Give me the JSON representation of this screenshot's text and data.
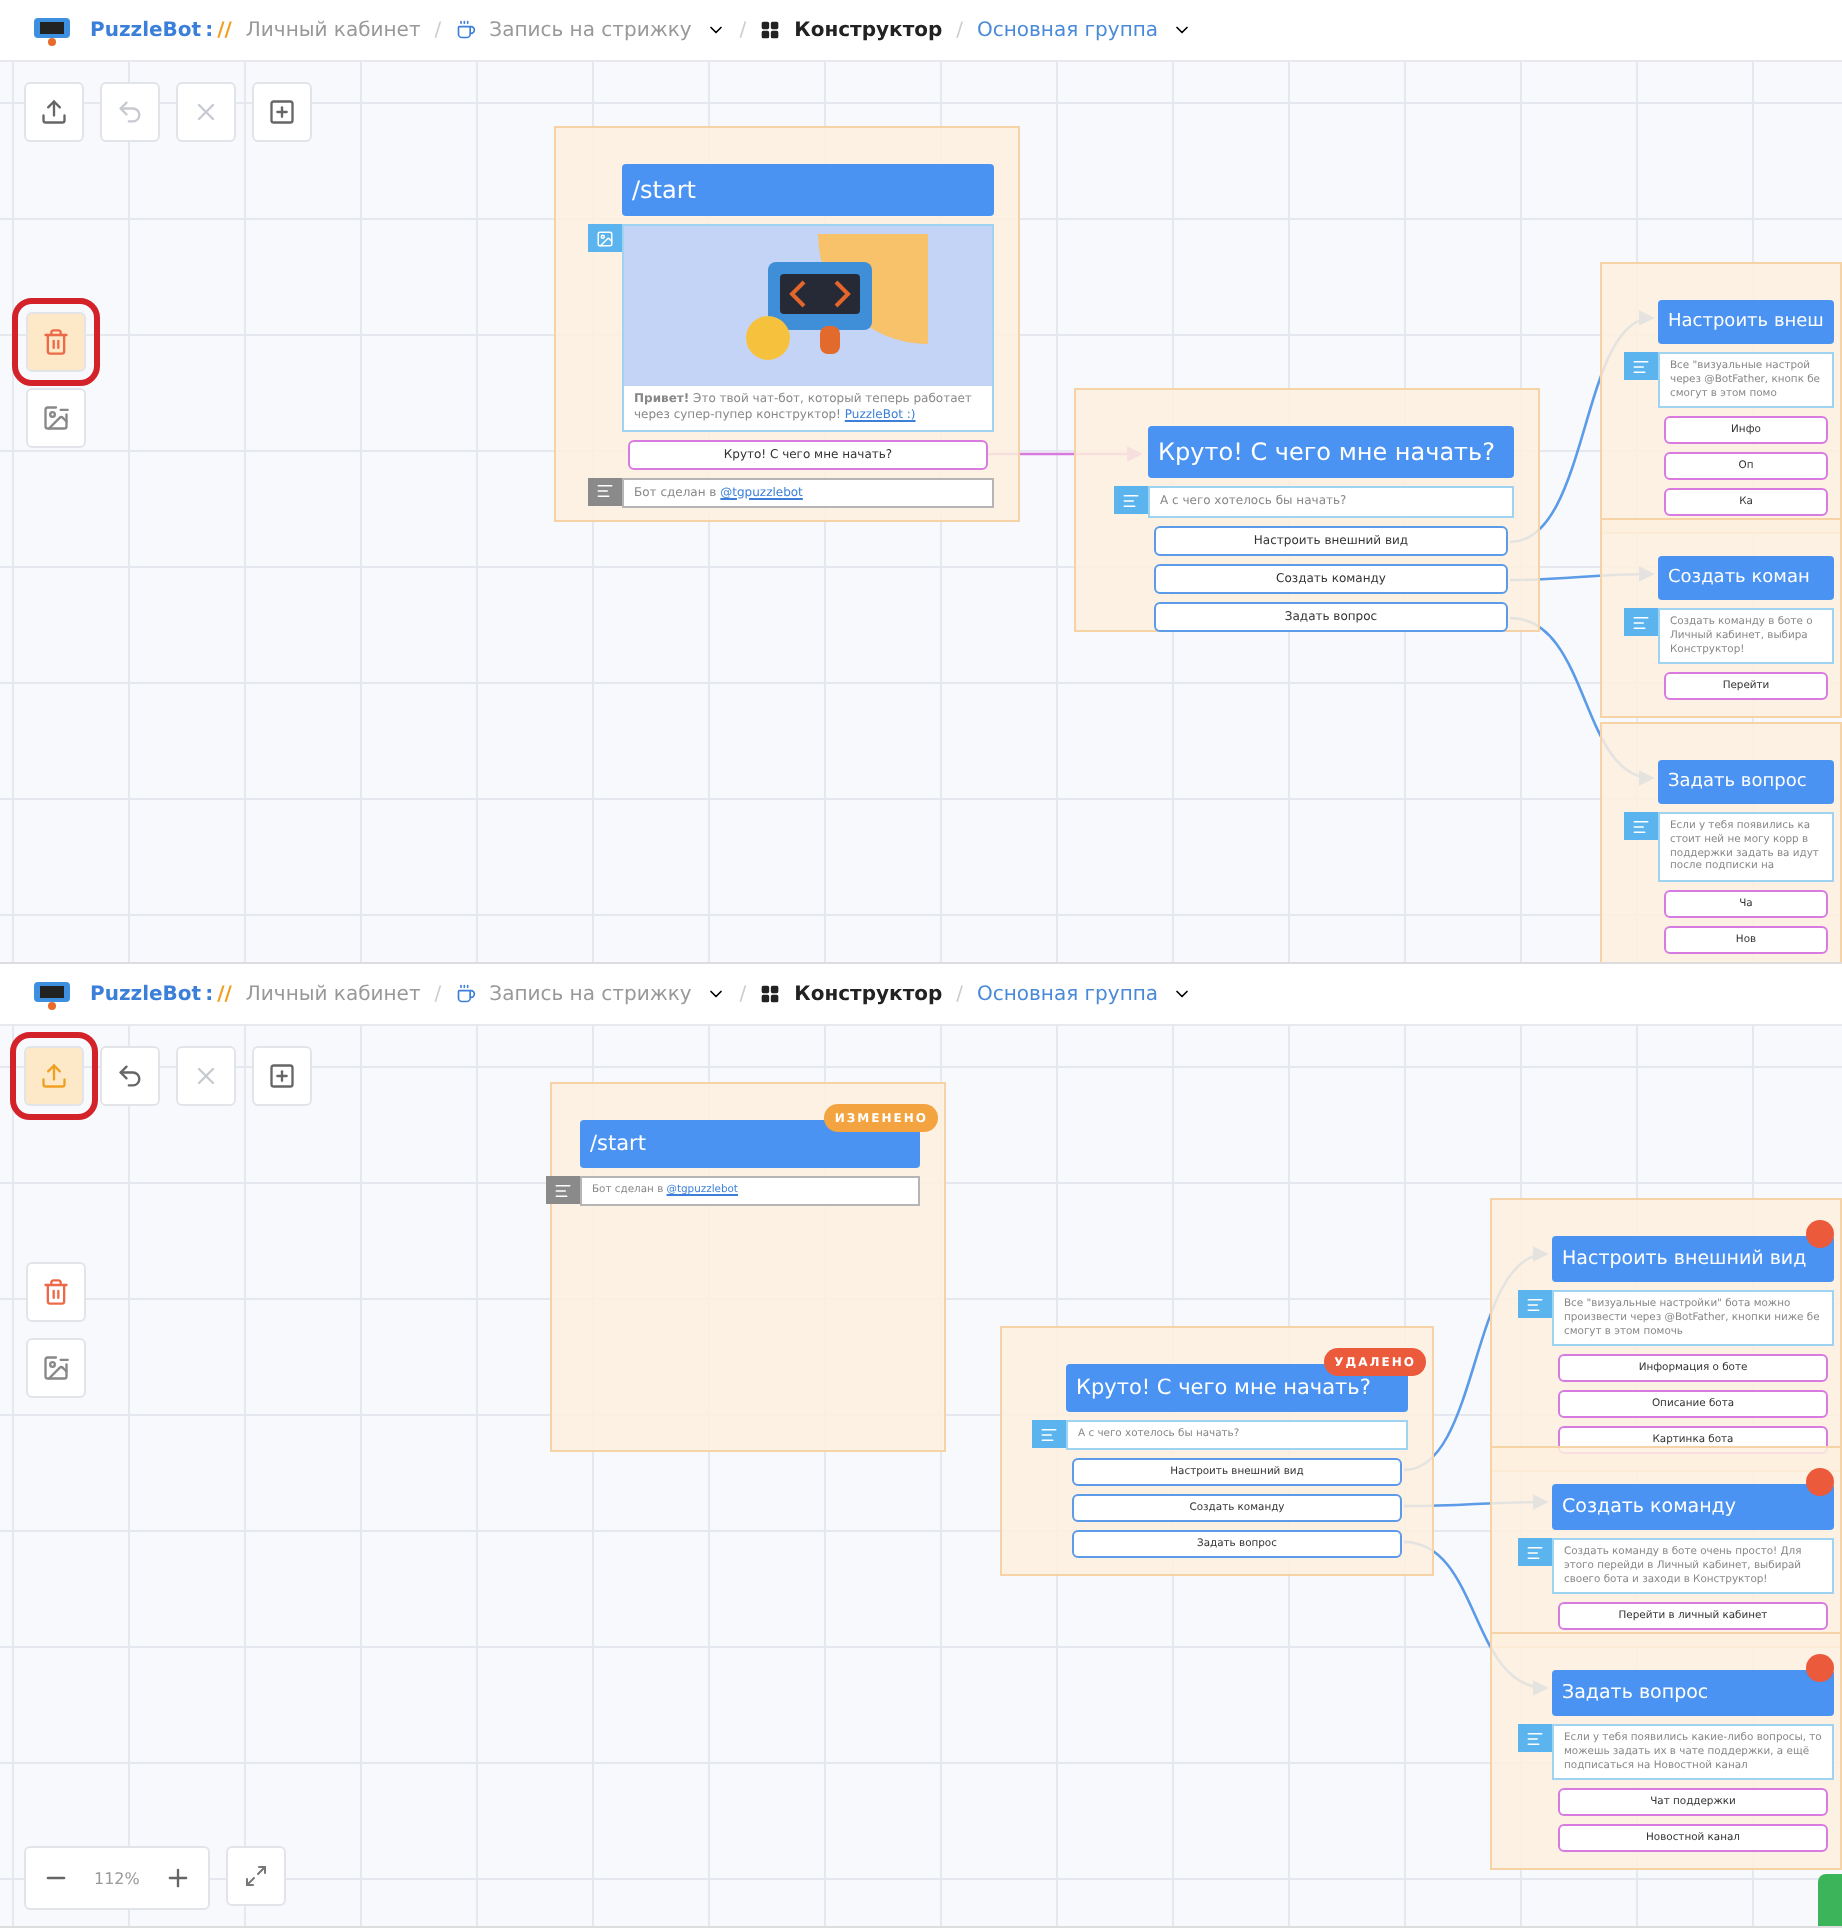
{
  "screens": [
    {
      "breadcrumb": [
        {
          "kind": "brand",
          "text": "PuzzleBot"
        },
        {
          "kind": "colon",
          "text": ":"
        },
        {
          "kind": "accent",
          "text": "//"
        },
        {
          "kind": "link",
          "text": "Личный кабинет"
        },
        {
          "kind": "separator",
          "text": "/"
        },
        {
          "kind": "project",
          "text": "Запись на стрижку"
        },
        {
          "kind": "separator",
          "text": "/"
        },
        {
          "kind": "section",
          "text": "Конструктор"
        },
        {
          "kind": "separator",
          "text": "/"
        },
        {
          "kind": "group",
          "text": "Основная группа"
        }
      ],
      "toolbar": [
        {
          "kind": "upload",
          "highlighted": false,
          "disabled": false
        },
        {
          "kind": "undo",
          "highlighted": false,
          "disabled": true
        },
        {
          "kind": "close",
          "highlighted": false,
          "disabled": true
        },
        {
          "kind": "add",
          "highlighted": false,
          "disabled": false
        }
      ],
      "side_tools": [
        {
          "kind": "delete",
          "highlighted": true
        },
        {
          "kind": "image",
          "highlighted": false
        }
      ],
      "nodes": [
        {
          "title": "/start",
          "blocks": [
            {
              "kind": "image",
              "caption": "**Привет!** Это твой чат-бот, который теперь работает через супер-пупер конструктор!",
              "link": "PuzzleBot :)"
            },
            {
              "kind": "inline_button",
              "text": "Круто! С чего мне начать?"
            },
            {
              "kind": "system_text",
              "text": "Бот сделан в",
              "link": "@tgpuzzlebot"
            }
          ]
        },
        {
          "title": "Круто! С чего мне начать?",
          "blocks": [
            {
              "kind": "text",
              "text": "А с чего хотелось бы начать?"
            },
            {
              "kind": "reply_button",
              "text": "Настроить внешний вид"
            },
            {
              "kind": "reply_button",
              "text": "Создать команду"
            },
            {
              "kind": "reply_button",
              "text": "Задать вопрос"
            }
          ]
        },
        {
          "title": "Настроить внеш",
          "blocks": [
            {
              "kind": "text",
              "text": "Все \"визуальные настрой через @BotFather, кнопк бе смогут в этом помо"
            },
            {
              "kind": "inline_button",
              "text": "Инфо"
            },
            {
              "kind": "inline_button",
              "text": "Оп"
            },
            {
              "kind": "inline_button",
              "text": "Ка"
            }
          ]
        },
        {
          "title": "Создать коман",
          "blocks": [
            {
              "kind": "text",
              "text": "Создать команду в боте о Личный кабинет, выбира Конструктор!"
            },
            {
              "kind": "inline_button",
              "text": "Перейти"
            }
          ]
        },
        {
          "title": "Задать вопрос",
          "blocks": [
            {
              "kind": "text",
              "text": "Если у тебя появились ка стоит ней не могу корр в поддержки задать ва идут после подписки на"
            },
            {
              "kind": "inline_button",
              "text": "Ча"
            },
            {
              "kind": "inline_button",
              "text": "Нов"
            }
          ]
        }
      ]
    },
    {
      "breadcrumb": [
        {
          "kind": "brand",
          "text": "PuzzleBot"
        },
        {
          "kind": "colon",
          "text": ":"
        },
        {
          "kind": "accent",
          "text": "//"
        },
        {
          "kind": "link",
          "text": "Личный кабинет"
        },
        {
          "kind": "separator",
          "text": "/"
        },
        {
          "kind": "project",
          "text": "Запись на стрижку"
        },
        {
          "kind": "separator",
          "text": "/"
        },
        {
          "kind": "section",
          "text": "Конструктор"
        },
        {
          "kind": "separator",
          "text": "/"
        },
        {
          "kind": "group",
          "text": "Основная группа"
        }
      ],
      "toolbar": [
        {
          "kind": "upload",
          "highlighted": true,
          "disabled": false
        },
        {
          "kind": "undo",
          "highlighted": false,
          "disabled": false
        },
        {
          "kind": "close",
          "highlighted": false,
          "disabled": true
        },
        {
          "kind": "add",
          "highlighted": false,
          "disabled": false
        }
      ],
      "side_tools": [
        {
          "kind": "delete",
          "highlighted": false
        },
        {
          "kind": "image",
          "highlighted": false
        }
      ],
      "nodes": [
        {
          "title": "/start",
          "badge": {
            "text": "ИЗМЕНЕНО",
            "color": "#f3a33f"
          },
          "blocks": [
            {
              "kind": "system_text",
              "text": "Бот сделан в",
              "link": "@tgpuzzlebot"
            }
          ]
        },
        {
          "title": "Круто! С чего мне начать?",
          "badge": {
            "text": "УДАЛЕНО",
            "color": "#ec5a3c"
          },
          "blocks": [
            {
              "kind": "text",
              "text": "А с чего хотелось бы начать?"
            },
            {
              "kind": "reply_button",
              "text": "Настроить внешний вид"
            },
            {
              "kind": "reply_button",
              "text": "Создать команду"
            },
            {
              "kind": "reply_button",
              "text": "Задать вопрос"
            }
          ]
        },
        {
          "title": "Настроить внешний вид",
          "badge": {
            "color": "#ec5a3c"
          },
          "blocks": [
            {
              "kind": "text",
              "text": "Все \"визуальные настройки\" бота можно произвести через @BotFather, кнопки ниже бе смогут в этом помочь"
            },
            {
              "kind": "inline_button",
              "text": "Информация о боте"
            },
            {
              "kind": "inline_button",
              "text": "Описание бота"
            },
            {
              "kind": "inline_button",
              "text": "Картинка бота"
            }
          ]
        },
        {
          "title": "Создать команду",
          "badge": {
            "color": "#ec5a3c"
          },
          "blocks": [
            {
              "kind": "text",
              "text": "Создать команду в боте очень просто! Для этого перейди в Личный кабинет, выбирай своего бота и заходи в Конструктор!"
            },
            {
              "kind": "inline_button",
              "text": "Перейти в личный кабинет"
            }
          ]
        },
        {
          "title": "Задать вопрос",
          "badge": {
            "color": "#ec5a3c"
          },
          "blocks": [
            {
              "kind": "text",
              "text": "Если у тебя появились какие-либо вопросы, то можешь задать их в чате поддержки, а ещё подписаться на Новостной канал"
            },
            {
              "kind": "inline_button",
              "text": "Чат поддержки"
            },
            {
              "kind": "inline_button",
              "text": "Новостной канал"
            }
          ]
        }
      ],
      "zoom": {
        "value": "112%"
      }
    }
  ]
}
